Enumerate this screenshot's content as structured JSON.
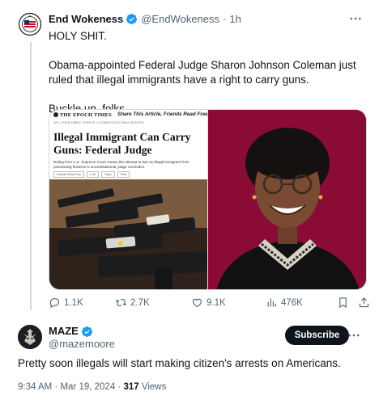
{
  "tweet1": {
    "author_name": "End Wokeness",
    "author_handle": "@EndWokeness",
    "separator": "·",
    "time_ago": "1h",
    "text_lines": [
      "HOLY SHIT.",
      "Obama-appointed Federal Judge Sharon Johnson Coleman just ruled that illegal immigrants have a right to carry guns.",
      "Buckle up, folks."
    ],
    "media": {
      "publication": "THE EPOCH TIMES",
      "share_text": "Share This Article, Friends Read Free",
      "breadcrumbs": "US  >  FEATURED TOPICS  >  CONSTITUTIONAL RIGHTS",
      "headline": "Illegal Immigrant Can Carry Guns: Federal Judge",
      "deck": "Ruling from U.S. Supreme Court means the attempt to ban an illegal immigrant from possessing firearms is unconstitutional, judge concludes.",
      "share_buttons": [
        "Friends Read Free",
        "2.1K",
        "Save",
        "Print"
      ]
    },
    "actions": {
      "replies": "1.1K",
      "reposts": "2.7K",
      "likes": "9.1K",
      "views": "476K"
    },
    "colors": {
      "verified": "#1d9bf0",
      "media_bg": "#8a0c34"
    }
  },
  "tweet2": {
    "author_name": "MAZE",
    "author_handle": "@mazemoore",
    "subscribe_label": "Subscribe",
    "text": "Pretty soon illegals will start making citizen's arrests on Americans.",
    "time": "9:34 AM",
    "date": "Mar 19, 2024",
    "views_count": "317",
    "views_label": "Views",
    "separator": "·"
  }
}
